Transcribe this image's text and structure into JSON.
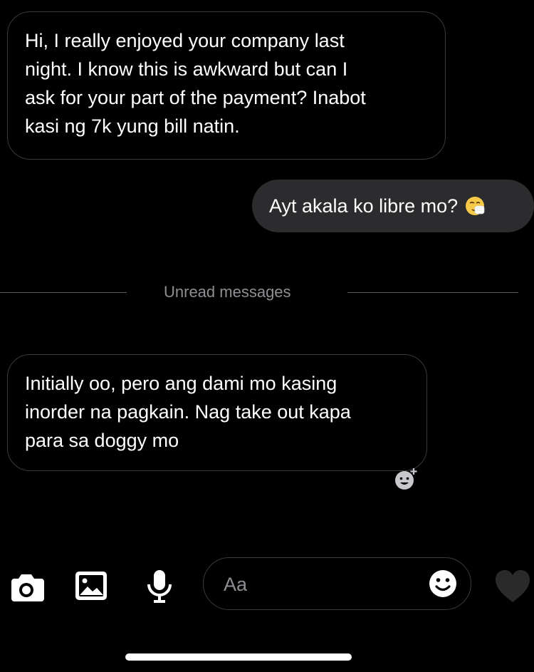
{
  "messages": [
    {
      "direction": "incoming",
      "lines": [
        "Hi, I really enjoyed your company last",
        "night. I know this is awkward but can I",
        "ask for your part of the payment? Inabot",
        "kasi ng 7k yung bill natin."
      ]
    },
    {
      "direction": "outgoing",
      "text": "Ayt akala ko libre mo?",
      "emoji": "sneezing-face-icon"
    },
    {
      "direction": "incoming",
      "lines": [
        "Initially oo, pero ang dami mo kasing",
        "inorder na pagkain. Nag take out kapa",
        "para sa doggy mo"
      ]
    }
  ],
  "divider": {
    "label": "Unread messages"
  },
  "composer": {
    "placeholder": "Aa",
    "icons": [
      "camera-icon",
      "gallery-icon",
      "microphone-icon",
      "emoji-icon",
      "heart-icon"
    ]
  },
  "colors": {
    "background": "#000000",
    "outgoing_bubble": "#2c2c2e",
    "incoming_border": "#3a3a3c",
    "muted_text": "#8e8e93",
    "heart": "#2a2a2a"
  }
}
